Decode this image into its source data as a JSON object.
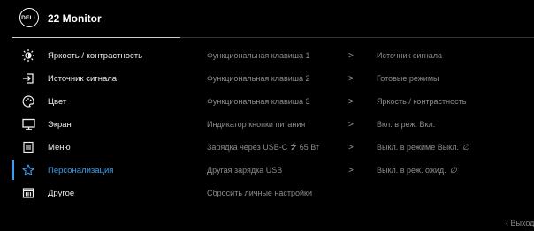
{
  "header": {
    "logo_text": "DELL",
    "title": "22 Monitor"
  },
  "menu": {
    "items": [
      {
        "label": "Яркость / контрастность",
        "icon": "brightness-icon"
      },
      {
        "label": "Источник сигнала",
        "icon": "input-source-icon"
      },
      {
        "label": "Цвет",
        "icon": "color-palette-icon"
      },
      {
        "label": "Экран",
        "icon": "display-monitor-icon"
      },
      {
        "label": "Меню",
        "icon": "menu-list-icon"
      },
      {
        "label": "Персонализация",
        "icon": "star-icon"
      },
      {
        "label": "Другое",
        "icon": "other-settings-icon"
      }
    ],
    "active_index": 5,
    "active_color": "#3a9ff0"
  },
  "settings": {
    "rows": [
      {
        "label": "Функциональная клавиша 1",
        "arrow": ">",
        "value": "Источник сигнала"
      },
      {
        "label": "Функциональная клавиша 2",
        "arrow": ">",
        "value": "Готовые режимы"
      },
      {
        "label": "Функциональная клавиша 3",
        "arrow": ">",
        "value": "Яркость / контрастность"
      },
      {
        "label": "Индикатор кнопки питания",
        "arrow": ">",
        "value": "Вкл. в реж. Вкл."
      },
      {
        "label_prefix": "Зарядка через USB-C",
        "usb_symbol": "⭍",
        "label_suffix": "65 Вт",
        "arrow": ">",
        "value": "Выкл. в режиме Выкл.",
        "value_symbol": "∅"
      },
      {
        "label": "Другая зарядка USB",
        "arrow": ">",
        "value": "Выкл. в реж. ожид.",
        "value_symbol": "∅"
      },
      {
        "label": "Сбросить личные настройки"
      }
    ]
  },
  "footer": {
    "exit_label": "‹ Выход"
  }
}
